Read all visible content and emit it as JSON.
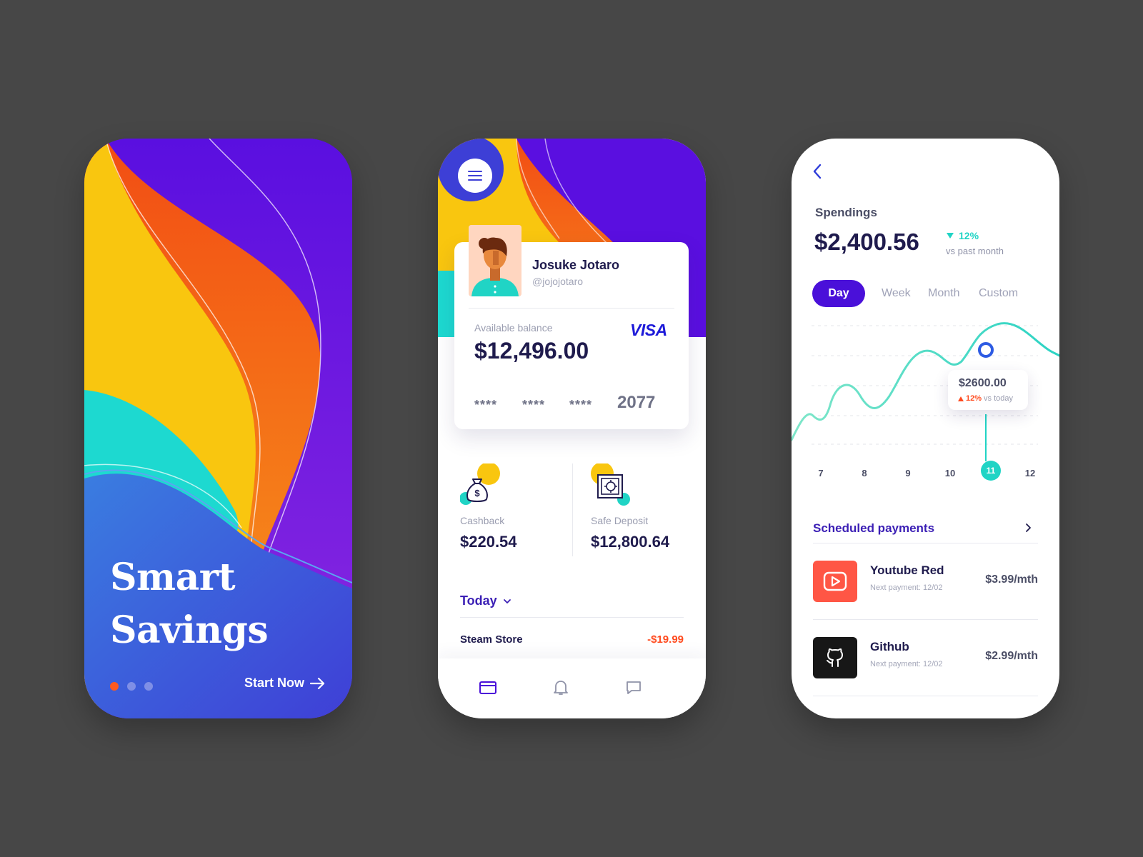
{
  "onboarding": {
    "title_line1": "Smart",
    "title_line2": "Savings",
    "pager_total": 3,
    "pager_active": 1,
    "cta_label": "Start Now"
  },
  "wallet": {
    "user": {
      "name": "Josuke Jotaro",
      "handle": "@jojojotaro"
    },
    "card": {
      "balance_label": "Available balance",
      "balance": "$12,496.00",
      "brand": "VISA",
      "masked_groups": [
        "****",
        "****",
        "****"
      ],
      "last4": "2077"
    },
    "stats": [
      {
        "label": "Cashback",
        "value": "$220.54",
        "icon": "money-bag-icon"
      },
      {
        "label": "Safe Deposit",
        "value": "$12,800.64",
        "icon": "safe-icon"
      }
    ],
    "period": "Today",
    "transactions": [
      {
        "name": "Steam Store",
        "amount": "-$19.99"
      }
    ],
    "tabbar": [
      "card-icon",
      "bell-icon",
      "chat-icon"
    ]
  },
  "spendings": {
    "title": "Spendings",
    "total": "$2,400.56",
    "delta": "12%",
    "delta_note": "vs past month",
    "periods": [
      "Day",
      "Week",
      "Month",
      "Custom"
    ],
    "active_period": "Day",
    "tooltip": {
      "value": "$2600.00",
      "delta": "12%",
      "note": "vs today"
    },
    "scheduled_title": "Scheduled payments",
    "payments": [
      {
        "name": "Youtube Red",
        "next": "Next payment: 12/02",
        "price": "$3.99/mth",
        "icon": "youtube-icon",
        "color": "#ff5645"
      },
      {
        "name": "Github",
        "next": "Next payment: 12/02",
        "price": "$2.99/mth",
        "icon": "github-icon",
        "color": "#171717"
      }
    ]
  },
  "chart_data": {
    "type": "line",
    "categories": [
      "7",
      "8",
      "9",
      "10",
      "11",
      "12"
    ],
    "highlight": "11",
    "grid": true,
    "colors": {
      "line": "#4fe0c8",
      "accent": "#20d4c5",
      "marker": "#2d5be3"
    }
  }
}
